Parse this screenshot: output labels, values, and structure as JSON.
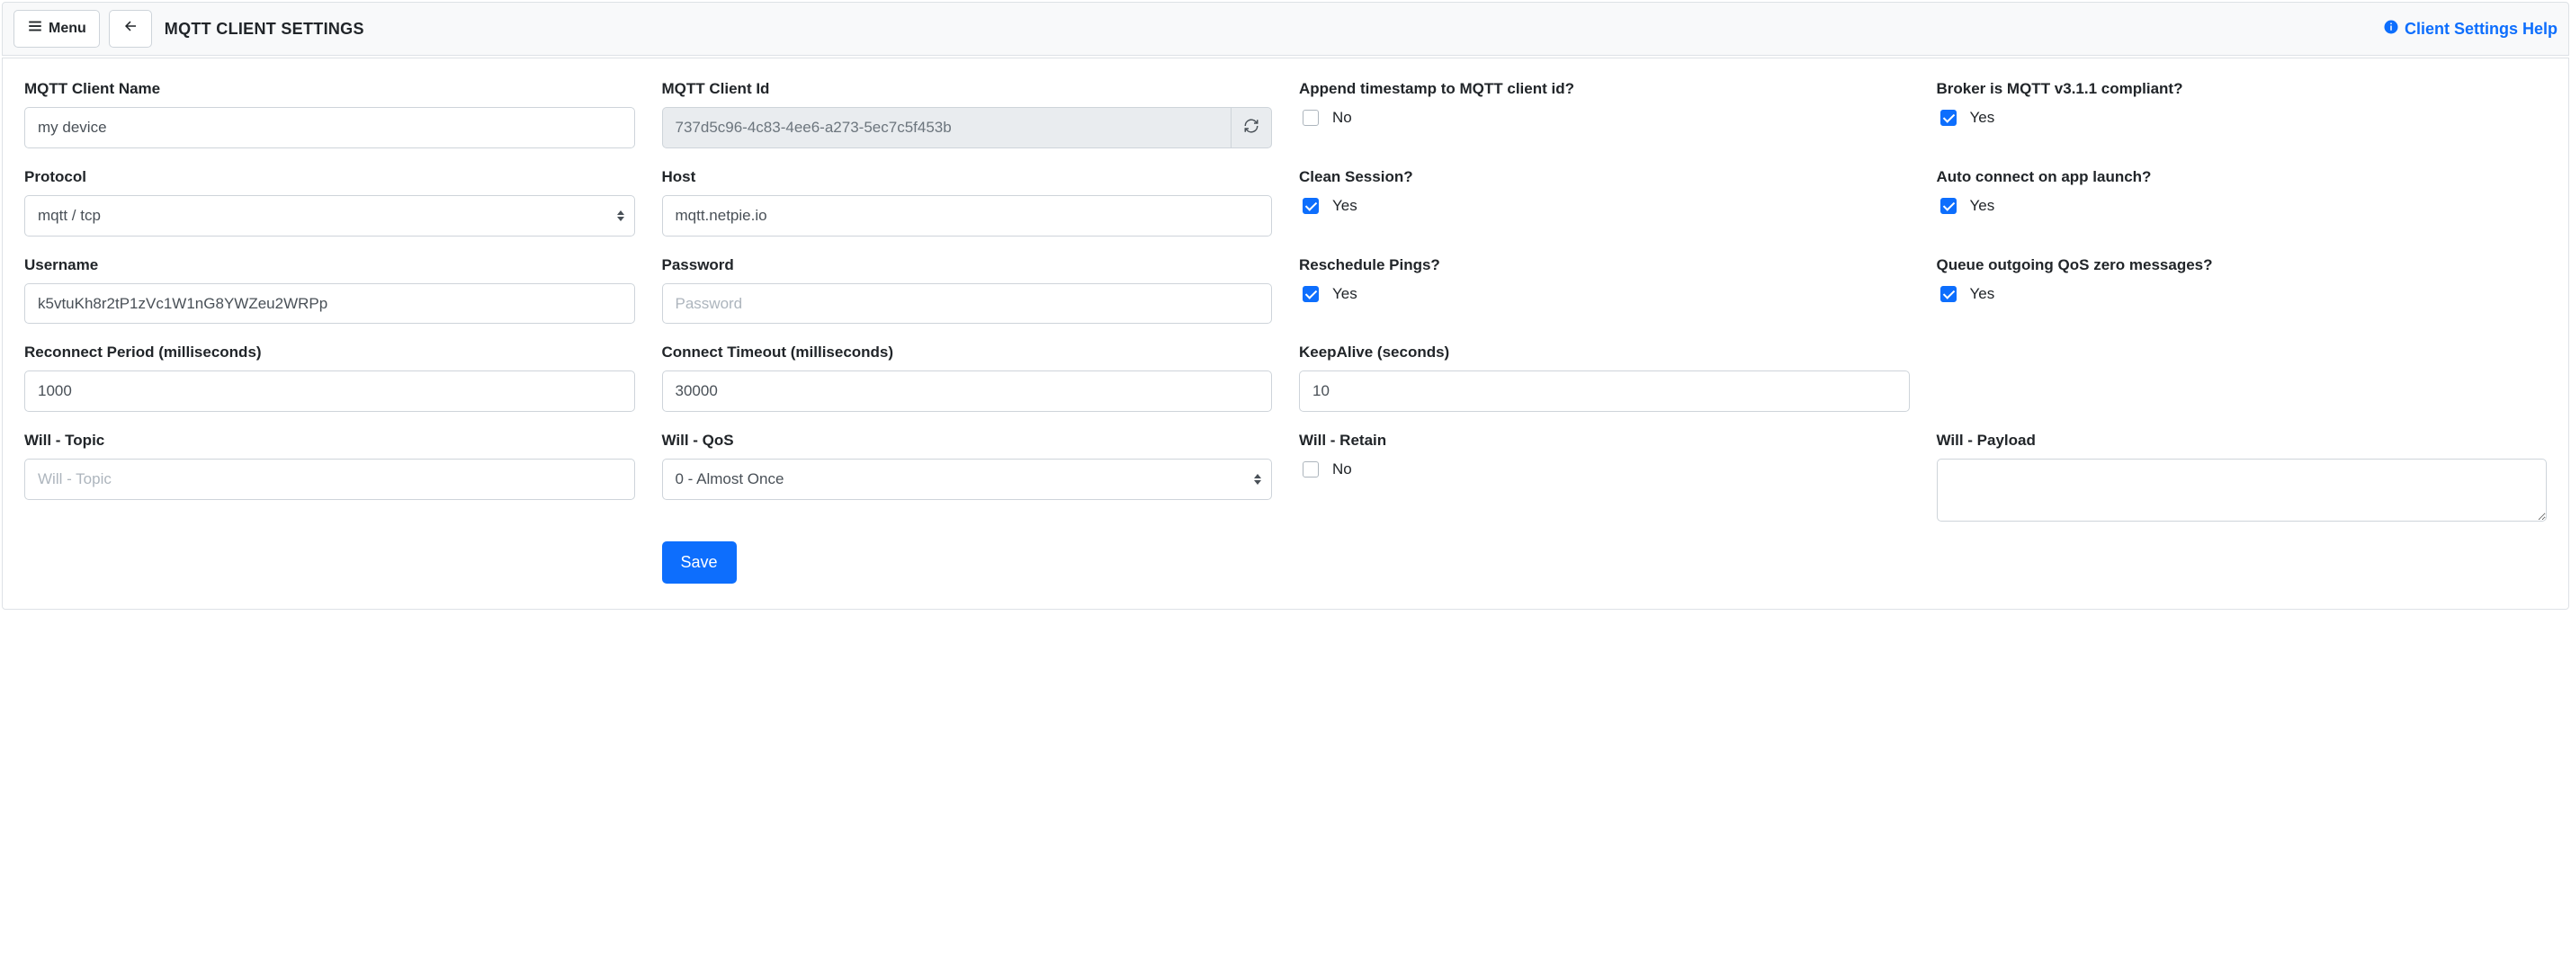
{
  "topbar": {
    "menu_label": "Menu",
    "title": "MQTT CLIENT SETTINGS",
    "help_label": "Client Settings Help"
  },
  "labels": {
    "client_name": "MQTT Client Name",
    "client_id": "MQTT Client Id",
    "append_ts": "Append timestamp to MQTT client id?",
    "broker_v311": "Broker is MQTT v3.1.1 compliant?",
    "protocol": "Protocol",
    "host": "Host",
    "clean_session": "Clean Session?",
    "auto_connect": "Auto connect on app launch?",
    "username": "Username",
    "password": "Password",
    "reschedule_pings": "Reschedule Pings?",
    "queue_qos0": "Queue outgoing QoS zero messages?",
    "reconnect_period": "Reconnect Period (milliseconds)",
    "connect_timeout": "Connect Timeout (milliseconds)",
    "keepalive": "KeepAlive (seconds)",
    "will_topic": "Will - Topic",
    "will_qos": "Will - QoS",
    "will_retain": "Will - Retain",
    "will_payload": "Will - Payload"
  },
  "values": {
    "client_name": "my device",
    "client_id": "737d5c96-4c83-4ee6-a273-5ec7c5f453b",
    "protocol": "mqtt / tcp",
    "host": "mqtt.netpie.io",
    "username": "k5vtuKh8r2tP1zVc1W1nG8YWZeu2WRPp",
    "password": "",
    "reconnect_period": "1000",
    "connect_timeout": "30000",
    "keepalive": "10",
    "will_topic": "",
    "will_qos": "0 - Almost Once",
    "will_payload": ""
  },
  "placeholders": {
    "password": "Password",
    "will_topic": "Will - Topic"
  },
  "checkboxes": {
    "append_ts": {
      "checked": false,
      "label": "No"
    },
    "broker_v311": {
      "checked": true,
      "label": "Yes"
    },
    "clean_session": {
      "checked": true,
      "label": "Yes"
    },
    "auto_connect": {
      "checked": true,
      "label": "Yes"
    },
    "reschedule_pings": {
      "checked": true,
      "label": "Yes"
    },
    "queue_qos0": {
      "checked": true,
      "label": "Yes"
    },
    "will_retain": {
      "checked": false,
      "label": "No"
    }
  },
  "actions": {
    "save": "Save"
  }
}
